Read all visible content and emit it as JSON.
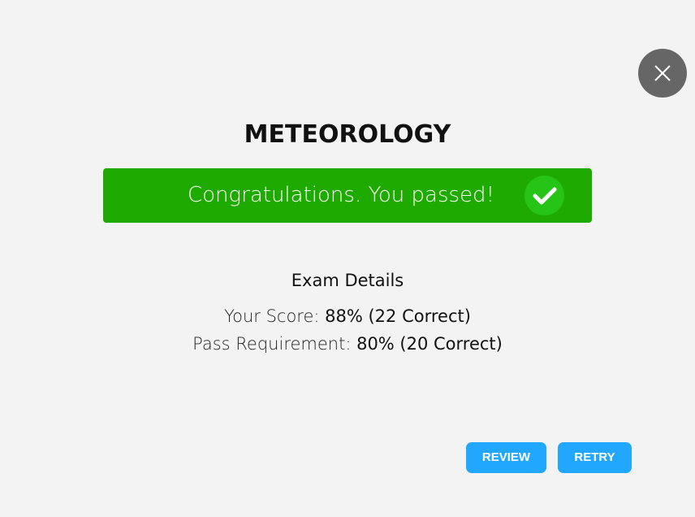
{
  "close": {
    "icon": "close-icon"
  },
  "title": "METEOROLOGY",
  "banner": {
    "message": "Congratulations. You passed!",
    "icon": "checkmark-icon",
    "color": "#1faa00"
  },
  "details": {
    "heading": "Exam Details",
    "score_label": "Your Score:",
    "score_value": "88% (22 Correct)",
    "pass_label": "Pass Requirement:",
    "pass_value": "80% (20 Correct)"
  },
  "buttons": {
    "review_label": "REVIEW",
    "retry_label": "RETRY",
    "color": "#22a7ff"
  }
}
